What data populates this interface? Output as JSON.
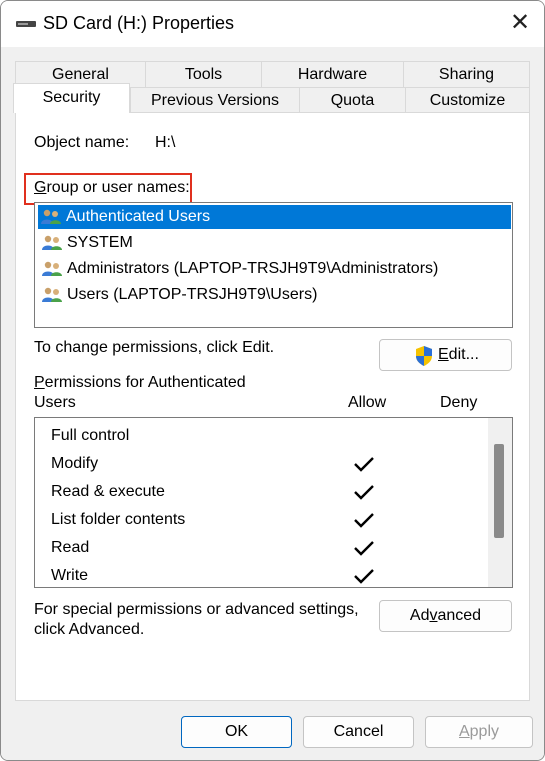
{
  "window": {
    "title": "SD Card (H:) Properties",
    "close_glyph": "✕"
  },
  "tabs": {
    "row1": [
      {
        "label": "General"
      },
      {
        "label": "Tools"
      },
      {
        "label": "Hardware"
      },
      {
        "label": "Sharing"
      }
    ],
    "row2": [
      {
        "label": "Security",
        "active": true
      },
      {
        "label": "Previous Versions"
      },
      {
        "label": "Quota"
      },
      {
        "label": "Customize"
      }
    ]
  },
  "security": {
    "object_name_label": "Object name:",
    "object_name_value": "H:\\",
    "group_label_pre": "",
    "group_label_ul": "G",
    "group_label_rest": "roup or user names:",
    "users": [
      {
        "name": "Authenticated Users",
        "selected": true
      },
      {
        "name": "SYSTEM"
      },
      {
        "name": "Administrators (LAPTOP-TRSJH9T9\\Administrators)"
      },
      {
        "name": "Users (LAPTOP-TRSJH9T9\\Users)"
      }
    ],
    "change_text": "To change permissions, click Edit.",
    "edit_button": {
      "ul": "E",
      "rest": "dit..."
    },
    "perm_label_ul": "P",
    "perm_label_line1_rest": "ermissions for Authenticated",
    "perm_label_line2": "Users",
    "allow_header": "Allow",
    "deny_header": "Deny",
    "permissions": [
      {
        "name": "Full control",
        "allow": false,
        "deny": false
      },
      {
        "name": "Modify",
        "allow": true,
        "deny": false
      },
      {
        "name": "Read & execute",
        "allow": true,
        "deny": false
      },
      {
        "name": "List folder contents",
        "allow": true,
        "deny": false
      },
      {
        "name": "Read",
        "allow": true,
        "deny": false
      },
      {
        "name": "Write",
        "allow": true,
        "deny": false
      }
    ],
    "special_text_line1": "For special permissions or advanced settings,",
    "special_text_line2": "click Advanced.",
    "advanced_button": {
      "pre": "Ad",
      "ul": "v",
      "rest": "anced"
    }
  },
  "footer": {
    "ok": "OK",
    "cancel": "Cancel",
    "apply_ul": "A",
    "apply_rest": "pply"
  },
  "colors": {
    "selection": "#0078d7",
    "highlight_box": "#e0301e",
    "primary_border": "#0067c0"
  },
  "icons": {
    "drive": "drive-icon",
    "users": "users-group-icon",
    "shield": "uac-shield-icon",
    "check": "checkmark-icon"
  }
}
